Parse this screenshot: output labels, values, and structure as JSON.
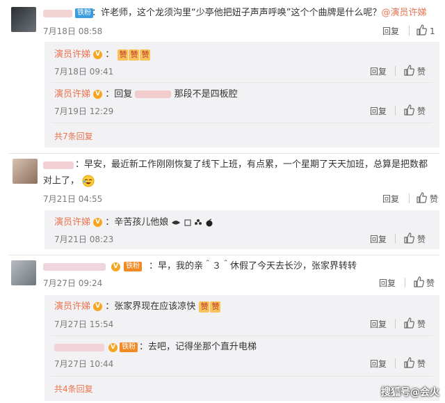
{
  "colors": {
    "name": "#eb7350",
    "subbox": "#f2f2f5",
    "badge_fan": "#3b9ce0",
    "badge_fan_orange": "#f08a24",
    "verified": "#f5a623"
  },
  "thread1": {
    "comment": {
      "badge": "铁粉",
      "text": "：许老师，这个龙须沟里“少亭他把妞子声声呼唤”这个个曲牌是什么呢？",
      "mention": "@演员许娣",
      "time": "7月18日 08:58",
      "reply_label": "回复"
    },
    "replies": [
      {
        "author": "演员许娣",
        "text": "：",
        "zan_count": 3,
        "zan_label": "赞",
        "time": "7月18日 09:41",
        "reply_label": "回复",
        "like_label": "赞"
      },
      {
        "author": "演员许娣",
        "text_prefix": "：回复",
        "text_suffix": "那段不是四板腔",
        "time": "7月19日 12:29",
        "reply_label": "回复",
        "like_label": "赞"
      }
    ],
    "more": "共7条回复"
  },
  "thread2": {
    "comment": {
      "text_line1": "：早安，最近新工作刚刚恢复了线下上班，有点累，一个星期了天天加班，总算是把数都",
      "text_line2": "对上了，",
      "time": "7月21日 04:55",
      "reply_label": "回复",
      "like_label": "赞"
    },
    "replies": [
      {
        "author": "演员许娣",
        "text": "：辛苦孩儿他娘",
        "time": "7月21日 08:23",
        "reply_label": "回复",
        "like_label": "赞"
      }
    ]
  },
  "thread3": {
    "comment": {
      "badge": "铁粉",
      "text": "：早，我的亲＾３＾休假了今天去长沙，张家界转转",
      "time": "7月27日 09:24",
      "reply_label": "回复",
      "like_label": "赞"
    },
    "replies": [
      {
        "author": "演员许娣",
        "text": "：张家界现在应该凉快",
        "zan_count": 2,
        "zan_label": "赞",
        "time": "7月27日 15:54",
        "reply_label": "回复",
        "like_label": "赞"
      },
      {
        "badge": "铁粉",
        "text": "：去吧，记得坐那个直升电梯",
        "time": "7月27日 10:44",
        "reply_label": "回复",
        "like_label": "赞"
      }
    ],
    "more": "共4条回复"
  },
  "watermark": "搜狐号@会火"
}
